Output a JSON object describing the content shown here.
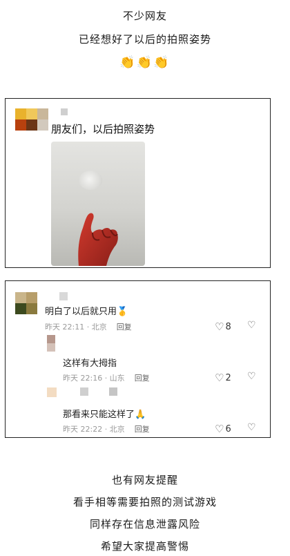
{
  "intro": {
    "line1": "不少网友",
    "line2": "已经想好了以后的拍照姿势",
    "emoji": "👏👏👏"
  },
  "post": {
    "text": "朋友们，以后拍照姿势"
  },
  "comments": [
    {
      "text": "明白了以后就只用🥇",
      "meta": "昨天 22:11 · 北京",
      "reply": "回复",
      "likes": "8"
    },
    {
      "text": "这样有大拇指",
      "meta": "昨天 22:16 · 山东",
      "reply": "回复",
      "likes": "2"
    },
    {
      "text": "那看来只能这样了🙏",
      "meta": "昨天 22:22 · 北京",
      "reply": "回复",
      "likes": "6"
    }
  ],
  "outro": {
    "line1": "也有网友提醒",
    "line2": "看手相等需要拍照的测试游戏",
    "line3": "同样存在信息泄露风险",
    "line4": "希望大家提高警惕"
  },
  "icons": {
    "like": "heart-outline-icon",
    "dislike": "broken-heart-icon"
  }
}
